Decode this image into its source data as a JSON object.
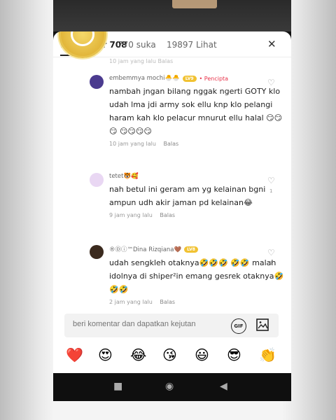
{
  "tabs": [
    {
      "label": "Komentar 708"
    },
    {
      "label": "770 suka"
    },
    {
      "label": "19897 Lihat"
    }
  ],
  "close_label": "✕",
  "cut_time": "10 jam yang lalu Balas",
  "comments": [
    {
      "username": "embemmya mochi🐣🐣",
      "level": "LV9",
      "creator_label": "• Pencipta",
      "text": "nambah jngan bilang nggak ngerti GOTY klo udah lma jdi army sok ellu knp klo pelangi haram kah klo pelacur mnurut ellu halal 😏😏😏 😏😏😏😏",
      "time": "10 jam yang lalu",
      "reply": "Balas",
      "likes": ""
    },
    {
      "username": "tetet🐯🥰",
      "level": "",
      "creator_label": "",
      "text": "nah betul ini geram am yg kelainan bgni ampun udh akir jaman pd kelainan😂",
      "time": "9 jam yang lalu",
      "reply": "Balas",
      "likes": "1"
    },
    {
      "username": "®Ⓓⓘ™Dina Rizqiana🤎",
      "level": "LV8",
      "creator_label": "",
      "text": "udah sengkleh otaknya🤣🤣🤣 🤣🤣 malah idolnya di shiper²in emang gesrek otaknya🤣🤣🤣",
      "time": "2 jam yang lalu",
      "reply": "Balas",
      "likes": "1"
    }
  ],
  "input": {
    "placeholder": "beri komentar dan dapatkan kejutan",
    "gif_label": "GIF"
  },
  "emojis": [
    "❤️",
    "😍",
    "😂",
    "😘",
    "😃",
    "😎",
    "👏"
  ],
  "nav": {
    "square": "■",
    "circle": "◉",
    "back": "◀"
  },
  "colors": {
    "creator": "#e8334a",
    "badge": "#f1c232"
  }
}
